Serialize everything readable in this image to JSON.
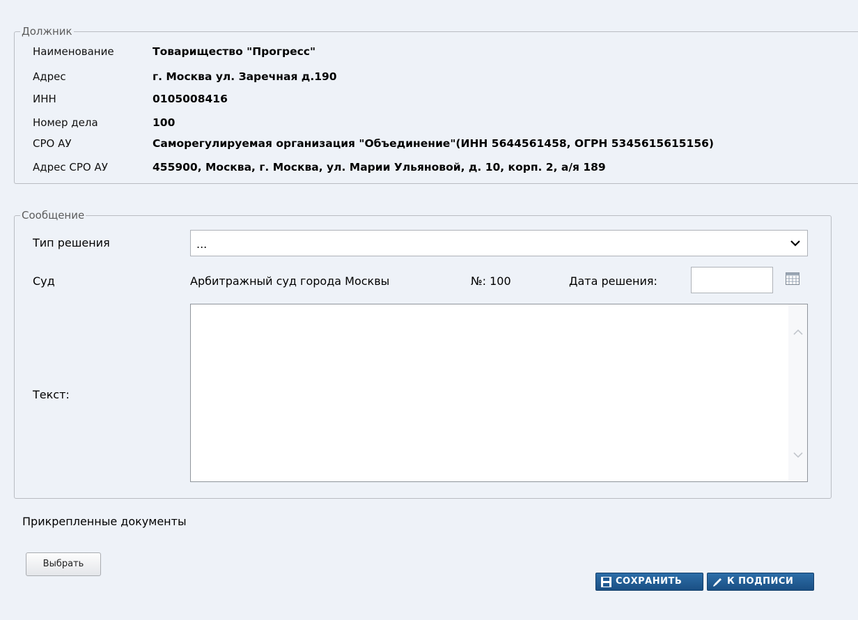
{
  "debtor": {
    "legend": "Должник",
    "rows": [
      {
        "label": "Наименование",
        "value": "Товарищество \"Прогресс\""
      },
      {
        "label": "Адрес",
        "value": "г. Москва ул. Заречная д.190"
      },
      {
        "label": "ИНН",
        "value": "0105008416"
      },
      {
        "label": "Номер дела",
        "value": "100"
      },
      {
        "label": "СРО АУ",
        "value": "Саморегулируемая организация \"Объединение\"(ИНН 5644561458, ОГРН 5345615615156)"
      },
      {
        "label": "Адрес СРО АУ",
        "value": "455900, Москва, г. Москва, ул. Марии Ульяновой, д. 10, корп. 2, а/я 189"
      }
    ]
  },
  "message": {
    "legend": "Сообщение",
    "decision_type_label": "Тип решения",
    "decision_type_value": "...",
    "court_label": "Суд",
    "court_name": "Арбитражный суд города Москвы",
    "case_number": "№: 100",
    "decision_date_label": "Дата решения:",
    "decision_date_value": "",
    "text_label": "Текст:",
    "text_value": ""
  },
  "attachments": {
    "title": "Прикрепленные документы",
    "choose_button": "Выбрать"
  },
  "actions": {
    "save_label": "СОХРАНИТЬ",
    "sign_label": "К ПОДПИСИ"
  },
  "colors": {
    "page_bg": "#eef2f8",
    "button_blue": "#1f5a93",
    "border": "#b9bcc2"
  }
}
